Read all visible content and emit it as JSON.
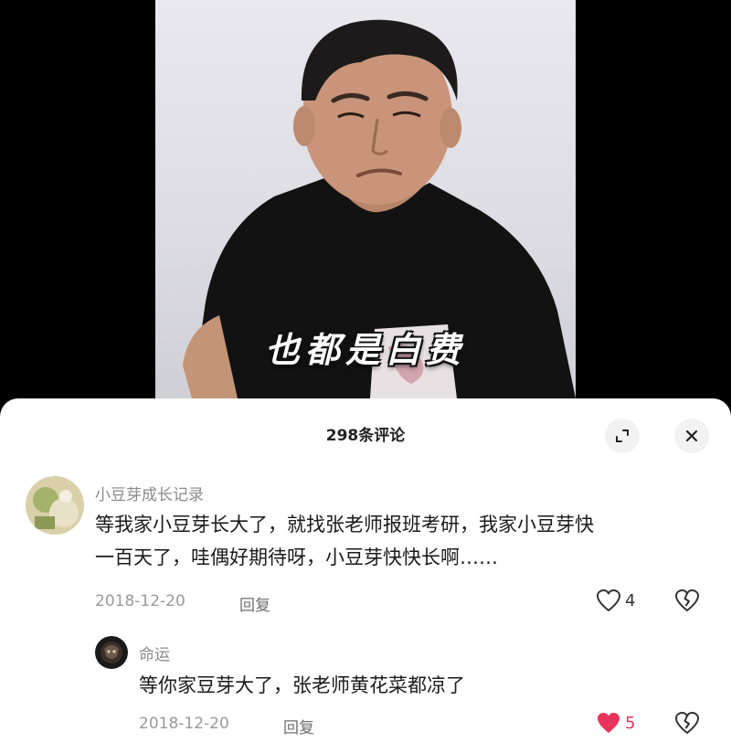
{
  "video": {
    "subtitle": "也都是白费"
  },
  "sheet": {
    "title": "298条评论"
  },
  "comments": [
    {
      "username": "小豆芽成长记录",
      "text_line1": "等我家小豆芽长大了，就找张老师报班考研，我家小豆芽快",
      "text_line2": "一百天了，哇偶好期待呀，小豆芽快快长啊……",
      "date": "2018-12-20",
      "reply_label": "回复",
      "likes": "4",
      "liked": false
    },
    {
      "username": "命运",
      "text": "等你家豆芽大了，张老师黄花菜都凉了",
      "date": "2018-12-20",
      "reply_label": "回复",
      "likes": "5",
      "liked": true
    }
  ],
  "colors": {
    "like_active": "#e8345a",
    "background_sheet": "#ffffff",
    "video_letterbox": "#000000"
  },
  "icons": {
    "expand": "expand-icon",
    "close": "close-icon",
    "heart": "heart-icon",
    "dislike": "broken-heart-icon"
  }
}
